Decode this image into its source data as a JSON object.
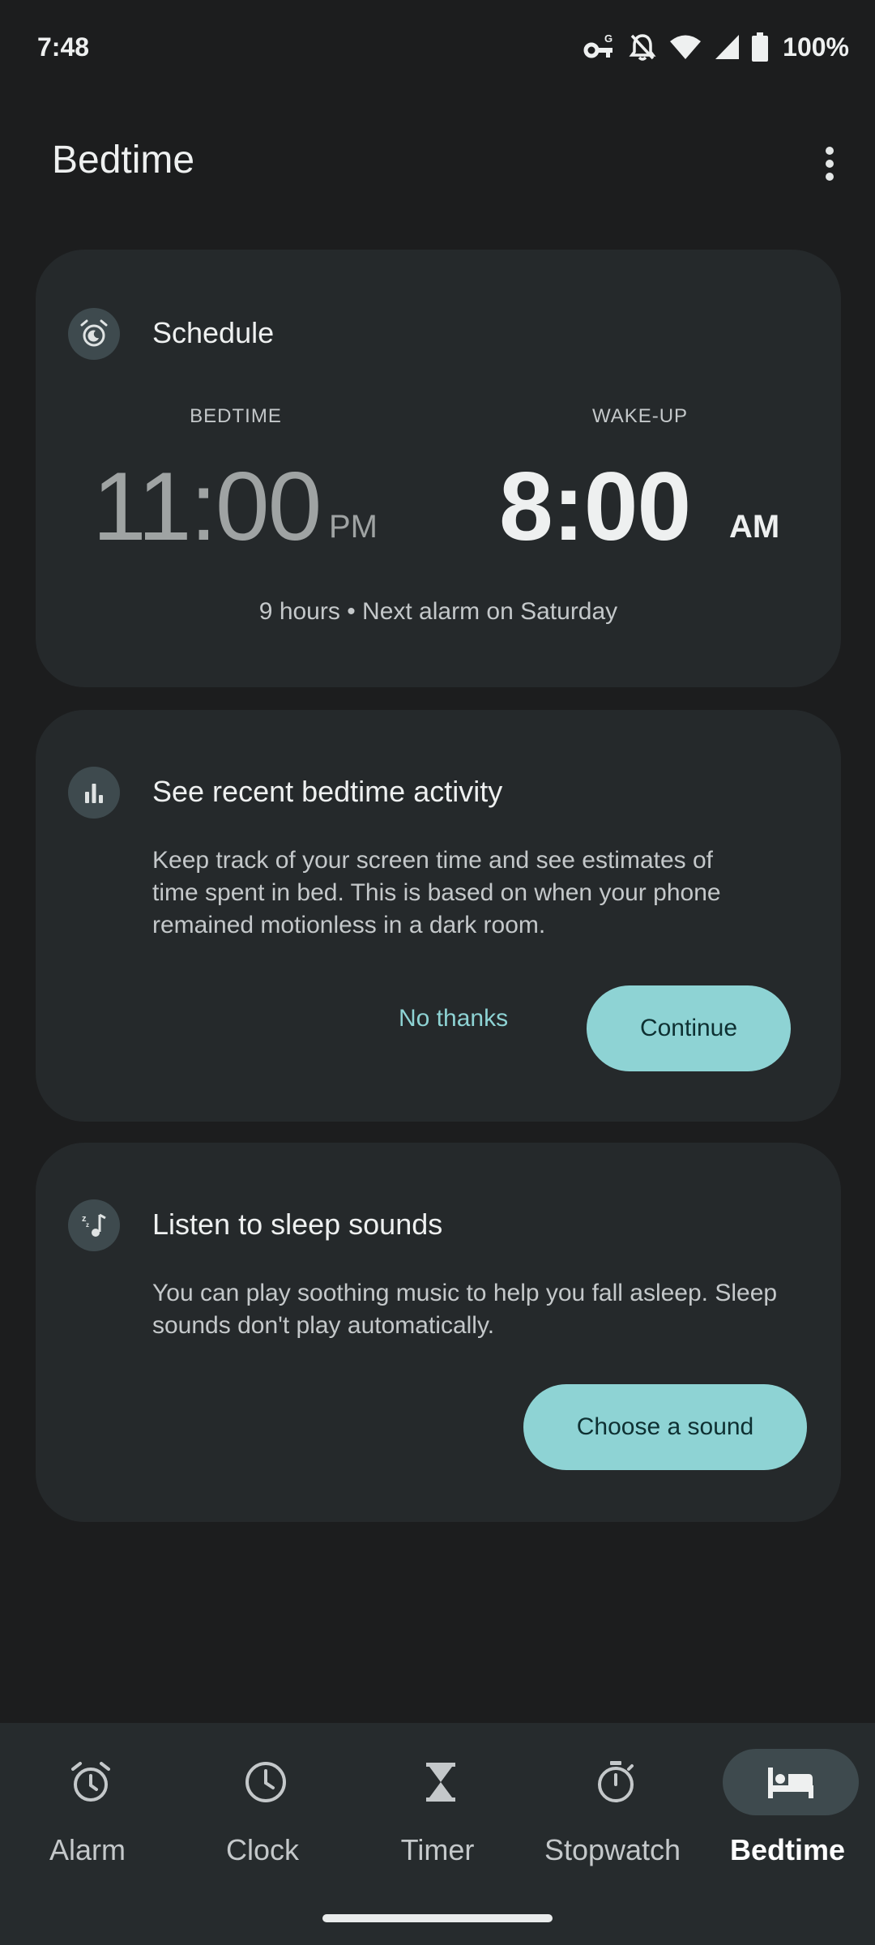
{
  "status_bar": {
    "time": "7:48",
    "battery": "100%",
    "icons": [
      "vpn-key-icon",
      "notifications-off-icon",
      "wifi-icon",
      "signal-icon",
      "battery-icon"
    ]
  },
  "app_bar": {
    "title": "Bedtime",
    "menu_icon": "more-vert-icon"
  },
  "schedule": {
    "title": "Schedule",
    "icon": "alarm-bedtime-icon",
    "bedtime_label": "BEDTIME",
    "bedtime_time": "11:00",
    "bedtime_ampm": "PM",
    "wakeup_label": "WAKE-UP",
    "wakeup_time": "8:00",
    "wakeup_ampm": "AM",
    "summary": "9 hours • Next alarm on Saturday"
  },
  "activity": {
    "title": "See recent bedtime activity",
    "icon": "bar-chart-icon",
    "body_lines": [
      "Keep track of your screen time and see estimates of",
      "time spent in bed. This is based on when your phone",
      "remained motionless in a dark room."
    ],
    "dismiss_label": "No thanks",
    "continue_label": "Continue"
  },
  "sounds": {
    "title": "Listen to sleep sounds",
    "icon": "sleep-music-icon",
    "body_lines": [
      "You can play soothing music to help you fall asleep. Sleep",
      "sounds don't play automatically."
    ],
    "choose_label": "Choose a sound"
  },
  "bottom_nav": {
    "items": [
      {
        "label": "Alarm",
        "icon": "alarm-icon",
        "active": false
      },
      {
        "label": "Clock",
        "icon": "clock-icon",
        "active": false
      },
      {
        "label": "Timer",
        "icon": "hourglass-icon",
        "active": false
      },
      {
        "label": "Stopwatch",
        "icon": "stopwatch-icon",
        "active": false
      },
      {
        "label": "Bedtime",
        "icon": "bed-icon",
        "active": true
      }
    ]
  },
  "colors": {
    "background": "#1c1d1e",
    "card": "#25292b",
    "accent": "#8ed3d4",
    "on_accent": "#0e3032",
    "nav_background": "#262b2d"
  }
}
